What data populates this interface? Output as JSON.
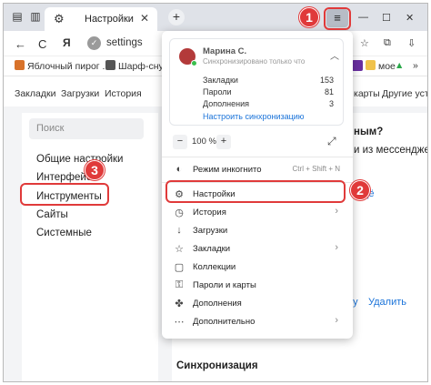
{
  "tabbar": {
    "active_tab_title": "Настройки",
    "close_glyph": "✕",
    "new_tab_glyph": "+",
    "menu_glyph": "≡",
    "minimize_glyph": "—",
    "maximize_glyph": "☐",
    "close_window_glyph": "✕"
  },
  "address": {
    "back_glyph": "←",
    "reload_glyph": "C",
    "logo": "Я",
    "url": "settings"
  },
  "bookmarks": [
    {
      "label": "Яблочный пирог ...",
      "icon": "pie-icon",
      "color": "#d8722a"
    },
    {
      "label": "Шарф-снуд ...",
      "icon": "scarf-icon",
      "color": "#555555"
    },
    {
      "label": "мое",
      "icon": "folder-icon",
      "color": "#f0c24b"
    }
  ],
  "settings_nav": [
    "Закладки",
    "Загрузки",
    "История",
    "карты",
    "Другие устр"
  ],
  "sidebar": {
    "search_placeholder": "Поиск",
    "items": [
      "Общие настройки",
      "Интерфейс",
      "Инструменты",
      "Сайты",
      "Системные"
    ]
  },
  "content": {
    "question_fragment": "ным?",
    "messengers_fragment": "и из мессенджеров",
    "more_link": "Ещё",
    "rename_link": "льзу",
    "delete_link": "Удалить",
    "sync_heading": "Синхронизация"
  },
  "menu": {
    "account": {
      "name": "Марина С.",
      "subtitle": "Синхронизировано только что",
      "rows": [
        {
          "label": "Закладки",
          "value": "153"
        },
        {
          "label": "Пароли",
          "value": "81"
        },
        {
          "label": "Дополнения",
          "value": "3"
        }
      ],
      "sync_link": "Настроить синхронизацию"
    },
    "zoom": {
      "minus": "−",
      "value": "100 %",
      "plus": "+"
    },
    "items": [
      {
        "icon": "incognito-icon",
        "glyph": "◐",
        "label": "Режим инкогнито",
        "shortcut": "Ctrl + Shift + N",
        "chevron": false
      },
      {
        "icon": "settings-gear-icon",
        "glyph": "⚙",
        "label": "Настройки",
        "shortcut": "",
        "chevron": false
      },
      {
        "icon": "history-icon",
        "glyph": "◷",
        "label": "История",
        "shortcut": "",
        "chevron": true
      },
      {
        "icon": "download-icon",
        "glyph": "↓",
        "label": "Загрузки",
        "shortcut": "",
        "chevron": false
      },
      {
        "icon": "bookmark-icon",
        "glyph": "☆",
        "label": "Закладки",
        "shortcut": "",
        "chevron": true
      },
      {
        "icon": "collections-icon",
        "glyph": "▢",
        "label": "Коллекции",
        "shortcut": "",
        "chevron": false
      },
      {
        "icon": "key-icon",
        "glyph": "⚿",
        "label": "Пароли и карты",
        "shortcut": "",
        "chevron": false
      },
      {
        "icon": "extensions-icon",
        "glyph": "✤",
        "label": "Дополнения",
        "shortcut": "",
        "chevron": false
      },
      {
        "icon": "more-icon",
        "glyph": "⋯",
        "label": "Дополнительно",
        "shortcut": "",
        "chevron": true
      }
    ]
  },
  "steps": [
    "1",
    "2",
    "3"
  ],
  "colors": {
    "highlight": "#e03a3a",
    "link": "#1a73d9"
  }
}
